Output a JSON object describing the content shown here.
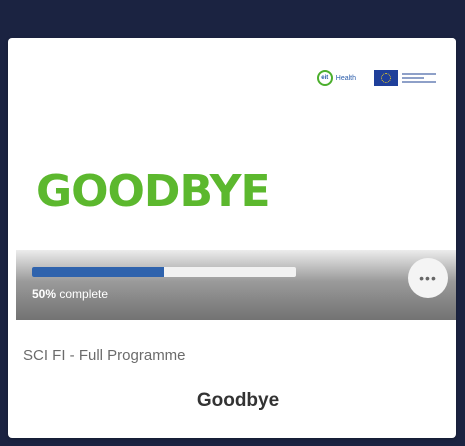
{
  "card": {
    "banner": {
      "title": "GOODBYE",
      "title_color": "#5cb82e",
      "logos": {
        "eit_icon": "eit-health-logo",
        "eit_mark": "eit",
        "eit_word": "Health",
        "eu_icon": "eu-flag-logo"
      }
    },
    "progress": {
      "percent": 50,
      "percent_text": "50%",
      "suffix": "complete",
      "bar_color": "#2f63ad"
    },
    "more_button": {
      "label": "•••",
      "icon": "more-dots-icon"
    },
    "program": "SCI FI - Full Programme",
    "course_title": "Goodbye"
  },
  "colors": {
    "page_background": "#1b2341",
    "card_background": "#ffffff"
  }
}
